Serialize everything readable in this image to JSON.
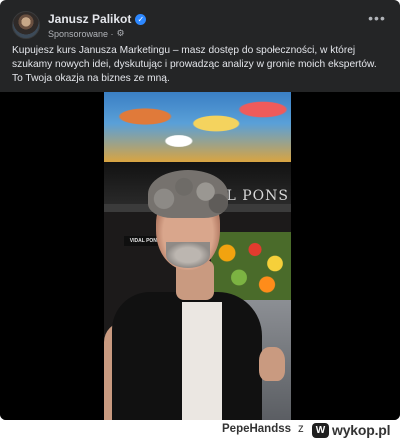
{
  "post": {
    "author": "Janusz Palikot",
    "sponsored_label": "Sponsorowane ·",
    "more_icon": "•••",
    "text": "Kupujesz kurs Janusza Marketingu – masz dostęp do społeczności, w której szukamy nowych idei, dyskutując i prowadząc analizy w gronie moich ekspertów. To Twoja okazja na biznes ze mną."
  },
  "video": {
    "stall_sign": "L PONS",
    "small_sign": "VIDAL PONS"
  },
  "footer": {
    "username": "PepeHandss",
    "separator": "z",
    "site": "wykop.pl"
  },
  "icons": {
    "verified": "verified-badge-icon",
    "audience": "gear-icon",
    "more": "more-options-icon",
    "wykop": "wykop-logo-icon"
  },
  "colors": {
    "card_bg": "#242526",
    "text_primary": "#e4e6eb",
    "text_secondary": "#b0b3b8",
    "verified_blue": "#2d88ff"
  }
}
